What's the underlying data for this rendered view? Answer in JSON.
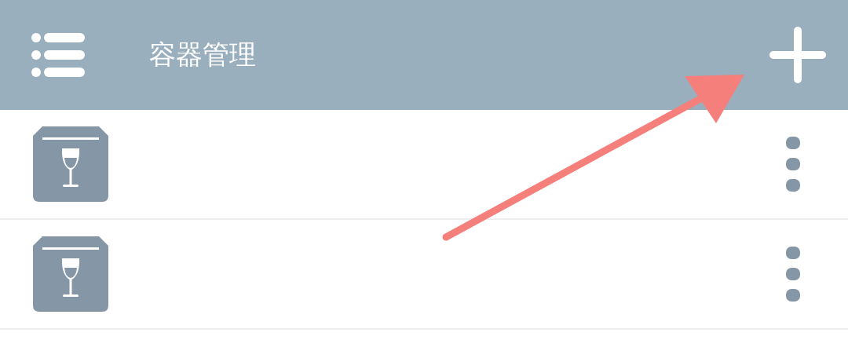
{
  "app_bar": {
    "title": "容器管理"
  },
  "rows": [
    {
      "kind": "container"
    },
    {
      "kind": "container"
    }
  ],
  "annotation": {
    "kind": "arrow"
  }
}
